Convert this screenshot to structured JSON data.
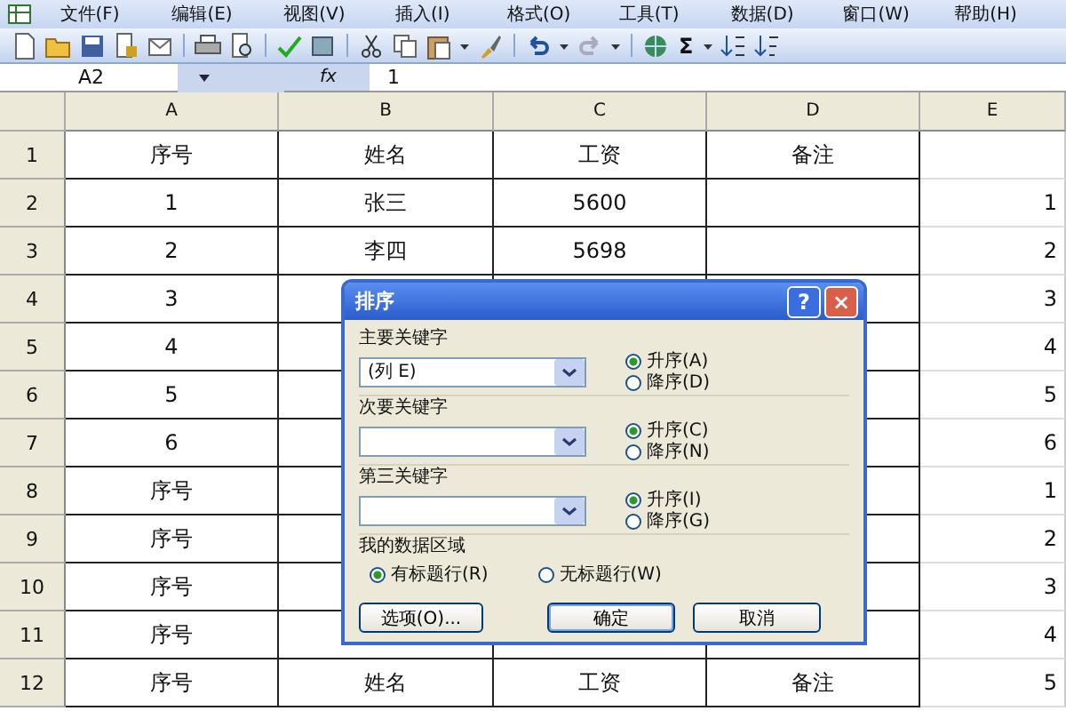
{
  "menu": [
    "文件(F)",
    "编辑(E)",
    "视图(V)",
    "插入(I)",
    "格式(O)",
    "工具(T)",
    "数据(D)",
    "窗口(W)",
    "帮助(H)"
  ],
  "toolbar": [
    {
      "kind": "new"
    },
    {
      "kind": "open"
    },
    {
      "kind": "save"
    },
    {
      "kind": "permission"
    },
    {
      "kind": "mail"
    },
    {
      "kind": "sep"
    },
    {
      "kind": "print"
    },
    {
      "kind": "preview"
    },
    {
      "kind": "sep"
    },
    {
      "kind": "spell"
    },
    {
      "kind": "research"
    },
    {
      "kind": "sep"
    },
    {
      "kind": "cut"
    },
    {
      "kind": "copy"
    },
    {
      "kind": "paste"
    },
    {
      "kind": "caret"
    },
    {
      "kind": "brush"
    },
    {
      "kind": "sep"
    },
    {
      "kind": "undo"
    },
    {
      "kind": "caret"
    },
    {
      "kind": "redo"
    },
    {
      "kind": "caret"
    },
    {
      "kind": "sep"
    },
    {
      "kind": "link"
    },
    {
      "kind": "text",
      "label": "Σ"
    },
    {
      "kind": "caret"
    },
    {
      "kind": "sortasc"
    },
    {
      "kind": "sortdesc"
    }
  ],
  "formula_bar": {
    "name_box": "A2",
    "fx": "fx",
    "value": "1"
  },
  "columns": [
    "A",
    "B",
    "C",
    "D",
    "E"
  ],
  "rows": [
    {
      "header": "1",
      "cells": [
        "序号",
        "姓名",
        "工资",
        "备注",
        null
      ]
    },
    {
      "header": "2",
      "cells": [
        "1",
        "张三",
        "5600",
        null,
        "1"
      ]
    },
    {
      "header": "3",
      "cells": [
        "2",
        "李四",
        "5698",
        null,
        "2"
      ]
    },
    {
      "header": "4",
      "cells": [
        "3",
        null,
        null,
        null,
        "3"
      ]
    },
    {
      "header": "5",
      "cells": [
        "4",
        null,
        null,
        null,
        "4"
      ]
    },
    {
      "header": "6",
      "cells": [
        "5",
        null,
        null,
        null,
        "5"
      ]
    },
    {
      "header": "7",
      "cells": [
        "6",
        null,
        null,
        null,
        "6"
      ]
    },
    {
      "header": "8",
      "cells": [
        "序号",
        null,
        null,
        null,
        "1"
      ]
    },
    {
      "header": "9",
      "cells": [
        "序号",
        null,
        null,
        null,
        "2"
      ]
    },
    {
      "header": "10",
      "cells": [
        "序号",
        null,
        null,
        null,
        "3"
      ]
    },
    {
      "header": "11",
      "cells": [
        "序号",
        null,
        null,
        null,
        "4"
      ]
    },
    {
      "header": "12",
      "cells": [
        "序号",
        "姓名",
        "工资",
        "备注",
        "5"
      ]
    }
  ],
  "dialog": {
    "title": "排序",
    "help": "?",
    "close": "×",
    "keys": [
      {
        "label": "主要关键字",
        "value": "(列 E)",
        "options": [
          {
            "label": "升序(A)",
            "selected": true
          },
          {
            "label": "降序(D)",
            "selected": false
          }
        ]
      },
      {
        "label": "次要关键字",
        "options": [
          {
            "label": "升序(C)",
            "selected": true
          },
          {
            "label": "降序(N)",
            "selected": false
          }
        ]
      },
      {
        "label": "第三关键字",
        "options": [
          {
            "label": "升序(I)",
            "selected": true
          },
          {
            "label": "降序(G)",
            "selected": false
          }
        ]
      }
    ],
    "range": {
      "label": "我的数据区域",
      "options": [
        {
          "label": "有标题行(R)",
          "selected": true
        },
        {
          "label": "无标题行(W)",
          "selected": false
        }
      ]
    },
    "buttons": [
      {
        "label": "选项(O)...",
        "default": false
      },
      {
        "label": "确定",
        "default": true
      },
      {
        "label": "取消",
        "default": false
      }
    ]
  }
}
